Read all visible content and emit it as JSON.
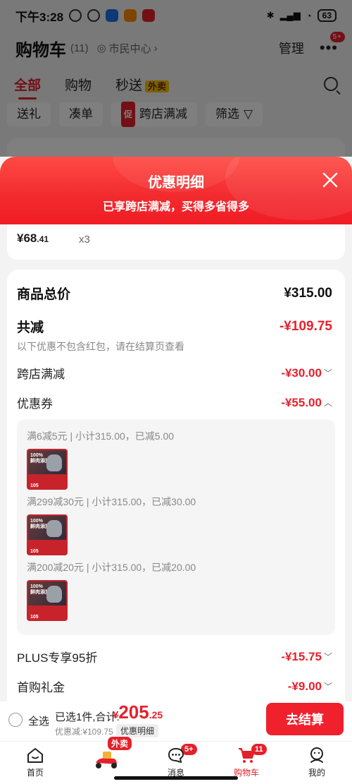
{
  "status_bar": {
    "time": "下午3:28",
    "battery": "63"
  },
  "header": {
    "title": "购物车",
    "count": "(11)",
    "location": "市民中心",
    "manage": "管理",
    "more_badge": "5+"
  },
  "tabs": [
    {
      "label": "全部"
    },
    {
      "label": "购物"
    },
    {
      "label": "秒送",
      "badge": "外卖"
    }
  ],
  "filters": [
    {
      "label": "送礼"
    },
    {
      "label": "凑单"
    },
    {
      "label": "跨店满减",
      "tag": "促"
    },
    {
      "label": "筛选"
    }
  ],
  "background_item": {
    "price_int": "¥68",
    "price_dec": ".41",
    "qty": "x3"
  },
  "popup": {
    "title": "优惠明细",
    "subtitle": "已享跨店满减，买得多省得多"
  },
  "details": {
    "total_label": "商品总价",
    "total_value": "¥315.00",
    "reduce_label": "共减",
    "reduce_value": "-¥109.75",
    "note": "以下优惠不包含红包，请在结算页查看",
    "cross_store_label": "跨店满减",
    "cross_store_value": "-¥30.00",
    "coupon_label": "优惠券",
    "coupon_value": "-¥55.00",
    "coupons": [
      {
        "text": "满6减5元 | 小计315.00，已减5.00"
      },
      {
        "text": "满299减30元 | 小计315.00，已减30.00"
      },
      {
        "text": "满200减20元 | 小计315.00，已减20.00"
      }
    ],
    "product_thumb": {
      "line1": "100%",
      "line2": "鲜肉添加",
      "num": "105"
    },
    "plus_label": "PLUS专享95折",
    "plus_value": "-¥15.75",
    "first_label": "首购礼金",
    "first_value": "-¥9.00"
  },
  "checkout": {
    "select_all": "全选",
    "selected": "已选1件,合计:",
    "currency": "¥",
    "total_int": "205",
    "total_dec": ".25",
    "discount": "优惠减:¥109.75",
    "detail_link": "优惠明细",
    "button": "去结算"
  },
  "nav": [
    {
      "label": "首页"
    },
    {
      "label": "",
      "bubble": "外卖"
    },
    {
      "label": "消息",
      "badge": "5+"
    },
    {
      "label": "购物车",
      "badge": "11"
    },
    {
      "label": "我的"
    }
  ],
  "colors": {
    "accent": "#e5212c",
    "popup_gradient_top": "#ff4a43",
    "popup_gradient_bottom": "#f01c24"
  }
}
